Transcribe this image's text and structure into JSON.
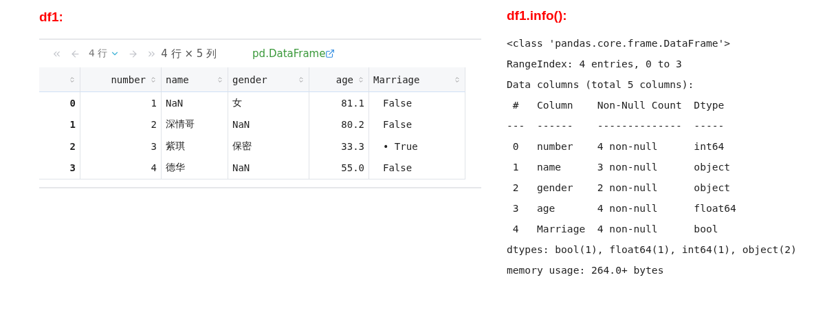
{
  "left_title": "df1:",
  "toolbar": {
    "page_size": "4 行",
    "shape": "4 行 × 5 列",
    "type_link": "pd.DataFrame"
  },
  "table": {
    "columns": [
      "",
      "number",
      "name",
      "gender",
      "age",
      "Marriage"
    ],
    "rows": [
      [
        "0",
        "1",
        "NaN",
        "女",
        "81.1",
        "False"
      ],
      [
        "1",
        "2",
        "深情哥",
        "NaN",
        "80.2",
        "False"
      ],
      [
        "2",
        "3",
        "紫琪",
        "保密",
        "33.3",
        "• True"
      ],
      [
        "3",
        "4",
        "德华",
        "NaN",
        "55.0",
        "False"
      ]
    ]
  },
  "right_title": "df1.info():",
  "info_lines": [
    "<class 'pandas.core.frame.DataFrame'>",
    "RangeIndex: 4 entries, 0 to 3",
    "Data columns (total 5 columns):",
    " #   Column    Non-Null Count  Dtype ",
    "---  ------    --------------  ----- ",
    " 0   number    4 non-null      int64  ",
    " 1   name      3 non-null      object ",
    " 2   gender    2 non-null      object ",
    " 3   age       4 non-null      float64",
    " 4   Marriage  4 non-null      bool   ",
    "dtypes: bool(1), float64(1), int64(1), object(2)",
    "memory usage: 264.0+ bytes"
  ]
}
